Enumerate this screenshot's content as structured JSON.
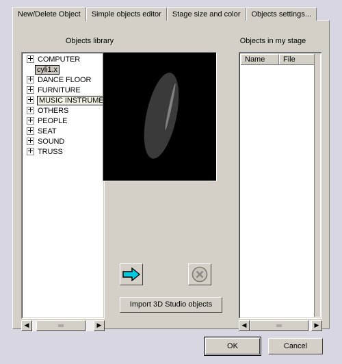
{
  "tabs": [
    {
      "label": "New/Delete Object",
      "active": true
    },
    {
      "label": "Simple objects editor",
      "active": false
    },
    {
      "label": "Stage size and color",
      "active": false
    },
    {
      "label": "Objects settings...",
      "active": false
    }
  ],
  "library": {
    "caption": "Objects library",
    "items": [
      {
        "label": "COMPUTER",
        "expandable": true,
        "child": false,
        "state": "normal"
      },
      {
        "label": "cyli1.x",
        "expandable": false,
        "child": true,
        "state": "selected"
      },
      {
        "label": "DANCE FLOOR",
        "expandable": true,
        "child": false,
        "state": "normal"
      },
      {
        "label": "FURNITURE",
        "expandable": true,
        "child": false,
        "state": "normal"
      },
      {
        "label": "MUSIC INSTRUMENT",
        "expandable": true,
        "child": false,
        "state": "focused"
      },
      {
        "label": "OTHERS",
        "expandable": true,
        "child": false,
        "state": "normal"
      },
      {
        "label": "PEOPLE",
        "expandable": true,
        "child": false,
        "state": "normal"
      },
      {
        "label": "SEAT",
        "expandable": true,
        "child": false,
        "state": "normal"
      },
      {
        "label": "SOUND",
        "expandable": true,
        "child": false,
        "state": "normal"
      },
      {
        "label": "TRUSS",
        "expandable": true,
        "child": false,
        "state": "normal"
      }
    ],
    "scroll_left_icon": "◀",
    "scroll_right_icon": "▶"
  },
  "preview": {
    "background_color": "#000000",
    "shape_color": "#3a3a3a",
    "shape": "ellipse-cylinder"
  },
  "stage": {
    "caption": "Objects in my stage",
    "columns": [
      "Name",
      "File"
    ],
    "rows": [],
    "scroll_left_icon": "◀",
    "scroll_right_icon": "▶"
  },
  "actions": {
    "add_label": "",
    "add_icon": "right-arrow-icon",
    "add_color": "#00ccdd",
    "delete_label": "",
    "delete_icon": "circle-x-icon",
    "delete_enabled": false,
    "import_label": "Import 3D Studio objects"
  },
  "footer": {
    "ok_label": "OK",
    "cancel_label": "Cancel"
  }
}
